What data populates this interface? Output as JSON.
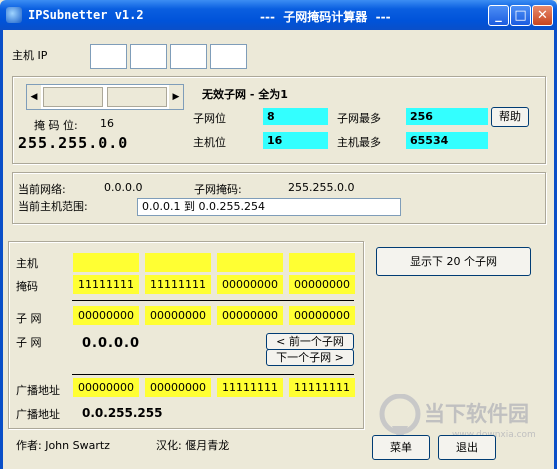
{
  "window": {
    "title": "IPSubnetter v1.2",
    "subtitle": "---  子网掩码计算器  ---",
    "min_label": "_",
    "max_label": "□",
    "close_label": "✕"
  },
  "host_ip": {
    "label": "主机 IP",
    "octets": [
      "",
      "",
      "",
      ""
    ]
  },
  "mask_panel": {
    "mask_bits_label": "掩 码 位:",
    "mask_bits_value": "16",
    "mask": "255.255.0.0",
    "status": "无效子网 - 全为1",
    "subnet_bits_label": "子网位",
    "subnet_bits_value": "8",
    "max_subnets_label": "子网最多",
    "max_subnets_value": "256",
    "help_button": "帮助",
    "host_bits_label": "主机位",
    "host_bits_value": "16",
    "max_hosts_label": "主机最多",
    "max_hosts_value": "65534"
  },
  "network_panel": {
    "current_network_label": "当前网络:",
    "current_network_value": "0.0.0.0",
    "subnet_mask_label": "子网掩码:",
    "subnet_mask_value": "255.255.0.0",
    "host_range_label": "当前主机范围:",
    "host_range_value": "0.0.0.1  到  0.0.255.254"
  },
  "binary_panel": {
    "host_label": "主机",
    "host_bits": [
      "",
      "",
      "",
      ""
    ],
    "mask_label": "掩码",
    "mask_bits": [
      "11111111",
      "11111111",
      "00000000",
      "00000000"
    ],
    "subnet_label": "子  网",
    "subnet_bits": [
      "00000000",
      "00000000",
      "00000000",
      "00000000"
    ],
    "subnet_label2": "子  网",
    "subnet_value": "0.0.0.0",
    "prev_subnet_button": "< 前一个子网",
    "next_subnet_button": "下一个子网 >",
    "broadcast_label": "广播地址",
    "broadcast_bits": [
      "00000000",
      "00000000",
      "11111111",
      "11111111"
    ],
    "broadcast_label2": "广播地址",
    "broadcast_value": "0.0.255.255"
  },
  "show_subnets_button": "显示下 20 个子网",
  "footer": {
    "author": "作者: John Swartz",
    "translator": "汉化: 偃月青龙",
    "menu_button": "菜单",
    "exit_button": "退出"
  },
  "watermark": {
    "brand": "当下软件园",
    "url": "www.downxia.com"
  },
  "colors": {
    "titlebar": "#0053d9",
    "cyan": "#33ffff",
    "yellow": "#ffff33",
    "face": "#ece9d8"
  }
}
